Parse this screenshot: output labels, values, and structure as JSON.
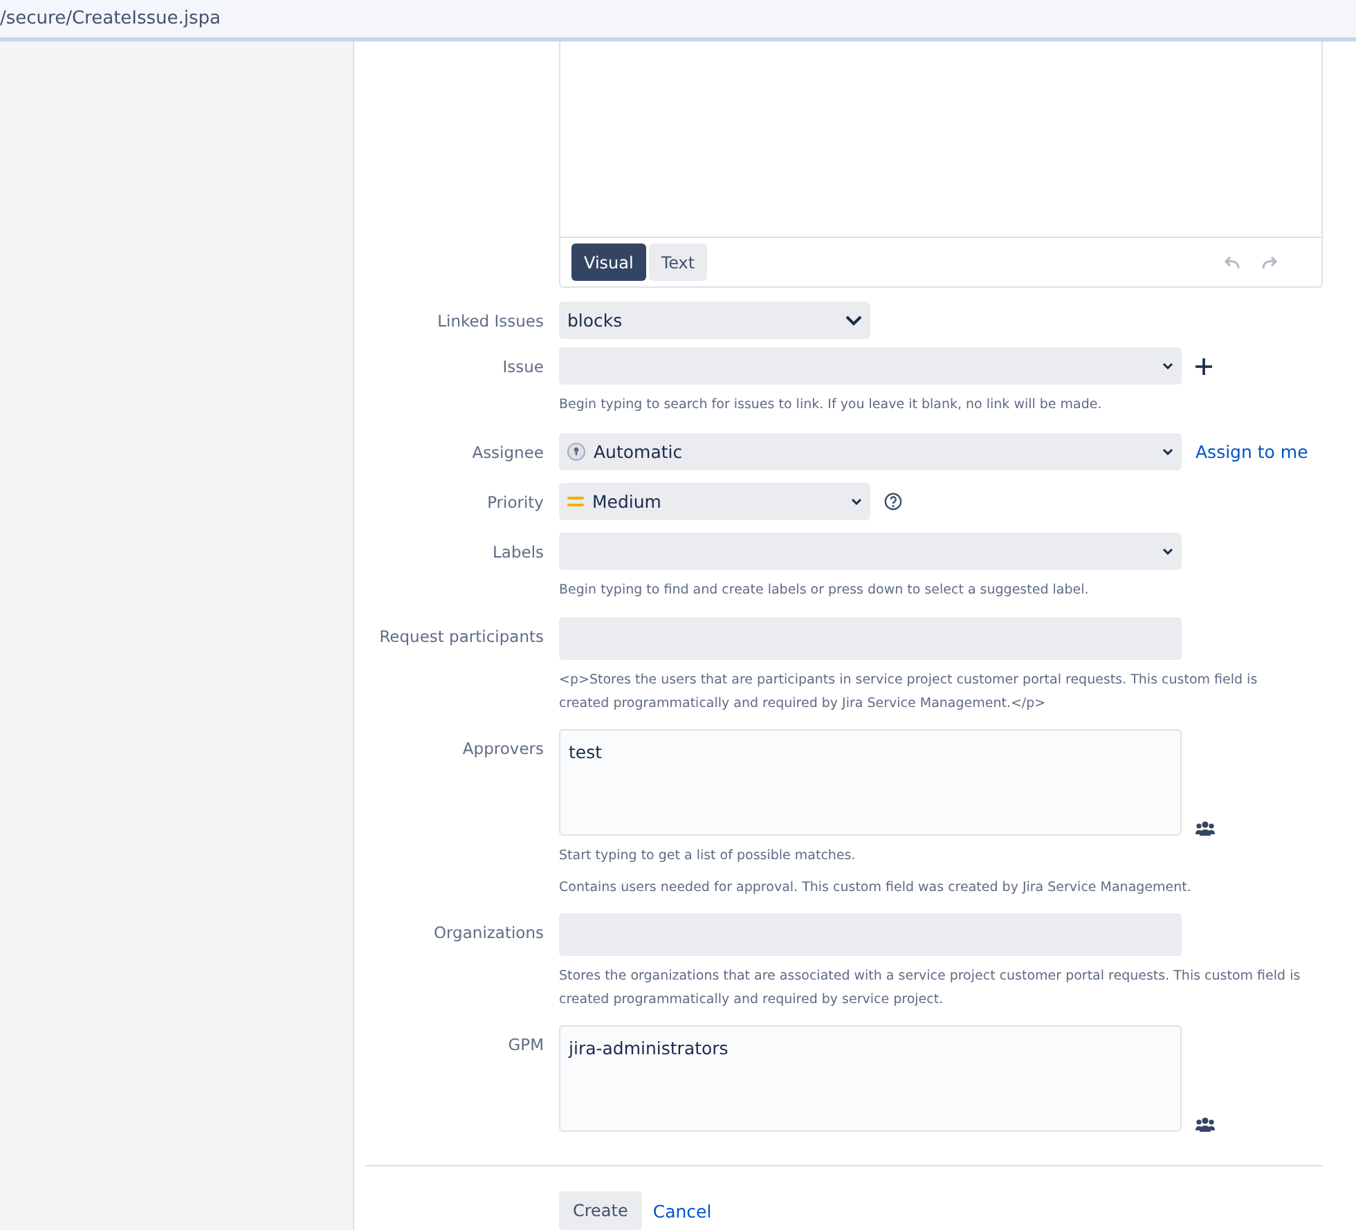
{
  "address_bar": {
    "url": "/secure/CreateIssue.jspa"
  },
  "editor": {
    "tabs": [
      {
        "label": "Visual",
        "selected": true
      },
      {
        "label": "Text",
        "selected": false
      }
    ]
  },
  "fields": [
    {
      "label": "Linked Issues",
      "kind": "select",
      "wide": false,
      "large_chevron": true,
      "value": "blocks"
    },
    {
      "label": "Issue",
      "kind": "select",
      "wide": true,
      "large_chevron": false,
      "add_button": true,
      "help": [
        "Begin typing to search for issues to link. If you leave it blank, no link will be made."
      ]
    },
    {
      "label": "Assignee",
      "kind": "select",
      "wide": true,
      "large_chevron": false,
      "value": "Automatic",
      "avatar": true,
      "link": "Assign to me"
    },
    {
      "label": "Priority",
      "kind": "select",
      "wide": false,
      "large_chevron": false,
      "value": "Medium",
      "priority_icon": true,
      "help_icon": true
    },
    {
      "label": "Labels",
      "kind": "select",
      "wide": true,
      "large_chevron": false,
      "help": [
        "Begin typing to find and create labels or press down to select a suggested label."
      ]
    },
    {
      "label": "Request participants",
      "kind": "text",
      "help": [
        "<p>Stores the users that are participants in service project customer portal requests. This custom field is created programmatically and required by Jira Service Management.</p>"
      ]
    },
    {
      "label": "Approvers",
      "kind": "textarea",
      "value": "test",
      "users_icon": true,
      "help": [
        "Start typing to get a list of possible matches.",
        "Contains users needed for approval. This custom field was created by Jira Service Management."
      ]
    },
    {
      "label": "Organizations",
      "kind": "text",
      "help": [
        "Stores the organizations that are associated with a service project customer portal requests. This custom field is created programmatically and required by service project."
      ]
    },
    {
      "label": "GPM",
      "kind": "textarea",
      "value": "jira-administrators",
      "users_icon": true
    }
  ],
  "buttons": {
    "submit": "Create",
    "cancel": "Cancel"
  }
}
